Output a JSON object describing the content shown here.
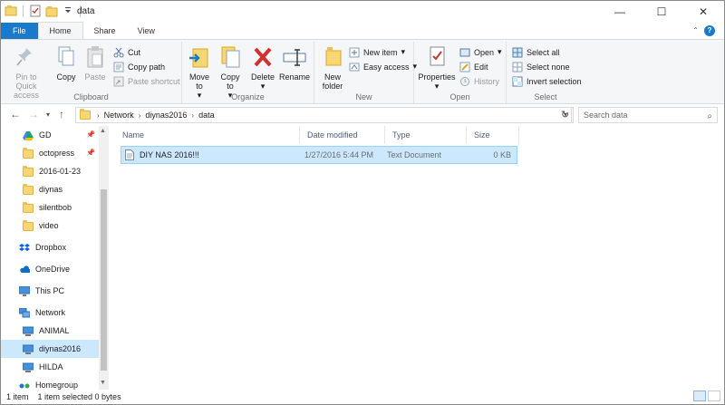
{
  "window": {
    "title": "data",
    "controls": {
      "minimize": "—",
      "maximize": "☐",
      "close": "✕"
    }
  },
  "ribbon_tabs": [
    "File",
    "Home",
    "Share",
    "View"
  ],
  "help": "?",
  "ribbon": {
    "clipboard": {
      "label": "Clipboard",
      "pin": "Pin to Quick access",
      "copy": "Copy",
      "paste": "Paste",
      "cut": "Cut",
      "copy_path": "Copy path",
      "paste_shortcut": "Paste shortcut"
    },
    "organize": {
      "label": "Organize",
      "move_to": "Move to",
      "copy_to": "Copy to",
      "delete": "Delete",
      "rename": "Rename"
    },
    "new": {
      "label": "New",
      "new_folder": "New folder",
      "new_item": "New item",
      "easy_access": "Easy access"
    },
    "open": {
      "label": "Open",
      "properties": "Properties",
      "open": "Open",
      "edit": "Edit",
      "history": "History"
    },
    "select": {
      "label": "Select",
      "select_all": "Select all",
      "select_none": "Select none",
      "invert": "Invert selection"
    }
  },
  "address": {
    "crumbs": [
      "Network",
      "diynas2016",
      "data"
    ],
    "search_placeholder": "Search data"
  },
  "nav": {
    "quick": [
      {
        "label": "GD",
        "pinned": true
      },
      {
        "label": "octopress",
        "pinned": true
      },
      {
        "label": "2016-01-23"
      },
      {
        "label": "diynas"
      },
      {
        "label": "silentbob"
      },
      {
        "label": "video"
      }
    ],
    "dropbox": "Dropbox",
    "onedrive": "OneDrive",
    "thispc": "This PC",
    "network": "Network",
    "network_items": [
      "ANIMAL",
      "diynas2016",
      "HILDA"
    ],
    "homegroup": "Homegroup"
  },
  "columns": [
    "Name",
    "Date modified",
    "Type",
    "Size"
  ],
  "files": [
    {
      "name": "DIY NAS 2016!!!",
      "date": "1/27/2016 5:44 PM",
      "type": "Text Document",
      "size": "0 KB"
    }
  ],
  "status": {
    "count": "1 item",
    "selected": "1 item selected  0 bytes"
  },
  "colors": {
    "accent": "#1979ca",
    "selection": "#cce8ff",
    "folder": "#f7d774"
  }
}
